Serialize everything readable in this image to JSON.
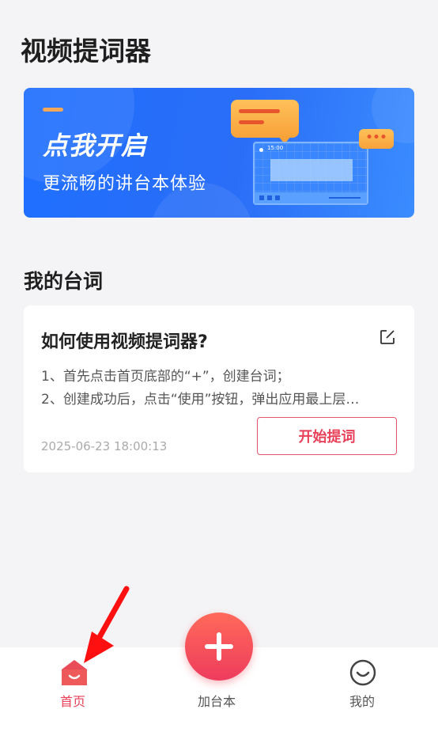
{
  "header": {
    "title": "视频提词器"
  },
  "banner": {
    "headline": "点我开启",
    "subtitle": "更流畅的讲台本体验",
    "screen_time": "15:00",
    "bubble_dots": "•••"
  },
  "my_scripts": {
    "section_title": "我的台词",
    "items": [
      {
        "title": "如何使用视频提词器?",
        "lines": [
          "1、首先点击首页底部的“+”，创建台词；",
          "2、创建成功后，点击“使用”按钮，弹出应用最上层…"
        ],
        "date": "2025-06-23 18:00:13",
        "action_label": "开始提词"
      }
    ]
  },
  "tabbar": {
    "home_label": "首页",
    "add_label": "加台本",
    "me_label": "我的"
  },
  "colors": {
    "accent": "#e84159",
    "banner_blue": "#1f6fff",
    "bubble_orange": "#f8a23a"
  },
  "icons": {
    "home": "home-icon",
    "add": "plus-icon",
    "me": "smile-icon",
    "edit": "edit-icon",
    "annotation": "red-arrow-icon"
  }
}
